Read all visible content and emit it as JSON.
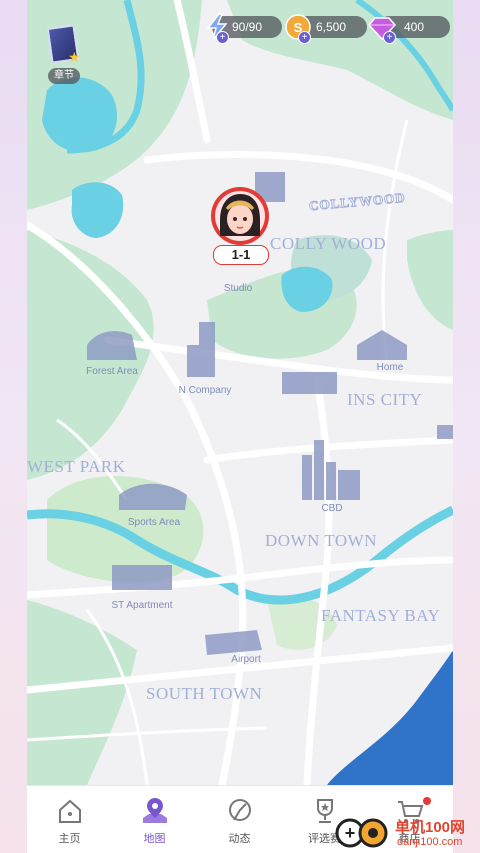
{
  "resources": {
    "energy": "90/90",
    "coins": "6,500",
    "gems": "400"
  },
  "chapter_label": "章节",
  "stage_marker": "1-1",
  "sign_text": "COLLYWOOD",
  "districts": [
    "COLLY WOOD",
    "INS CITY",
    "WEST PARK",
    "DOWN TOWN",
    "FANTASY BAY",
    "SOUTH TOWN"
  ],
  "places": [
    "Studio",
    "Forest Area",
    "N Company",
    "Home",
    "Sports Area",
    "CBD",
    "ST Apartment",
    "Airport"
  ],
  "tabs": [
    {
      "label": "主页",
      "icon": "home-icon"
    },
    {
      "label": "地图",
      "icon": "map-pin-icon"
    },
    {
      "label": "动态",
      "icon": "feed-icon"
    },
    {
      "label": "评选赛",
      "icon": "trophy-icon"
    },
    {
      "label": "商店",
      "icon": "shop-cart-icon"
    }
  ],
  "active_tab": "地图",
  "watermark": {
    "brand": "单机100网",
    "url": "danji100.com"
  },
  "colors": {
    "accent": "#7a55d0",
    "water": "#6ad0e3",
    "park": "#bfe3c9",
    "marker_ring": "#e23a35"
  }
}
